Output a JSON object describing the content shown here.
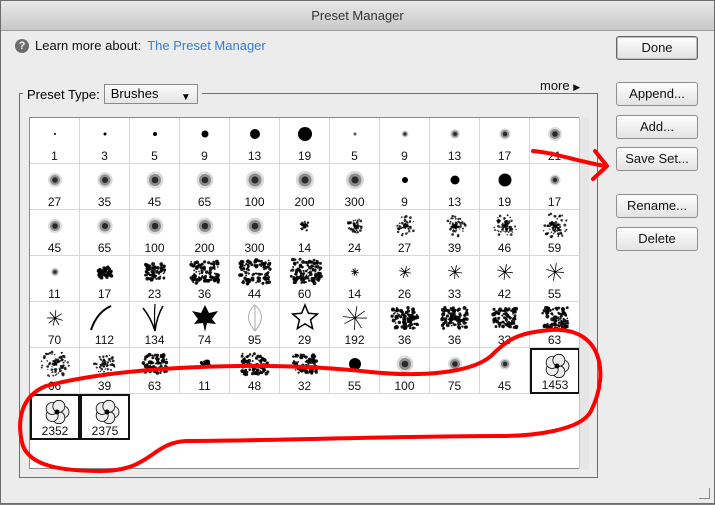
{
  "window": {
    "title": "Preset Manager"
  },
  "learn": {
    "prefix": "Learn more about:",
    "link": "The Preset Manager",
    "icon": "help-icon"
  },
  "buttons": {
    "done": "Done",
    "append": "Append...",
    "add": "Add...",
    "save_set": "Save Set...",
    "rename": "Rename...",
    "delete": "Delete"
  },
  "preset_type": {
    "label": "Preset Type:",
    "value": "Brushes"
  },
  "more": "more",
  "brushes": [
    {
      "label": "1",
      "style": "dot",
      "size": 1
    },
    {
      "label": "3",
      "style": "dot",
      "size": 1.5
    },
    {
      "label": "5",
      "style": "dot",
      "size": 2
    },
    {
      "label": "9",
      "style": "dot",
      "size": 3.5
    },
    {
      "label": "13",
      "style": "dot",
      "size": 5
    },
    {
      "label": "19",
      "style": "dot",
      "size": 7
    },
    {
      "label": "5",
      "style": "soft",
      "size": 1.5
    },
    {
      "label": "9",
      "style": "soft",
      "size": 2.5
    },
    {
      "label": "13",
      "style": "soft",
      "size": 3.5
    },
    {
      "label": "17",
      "style": "soft",
      "size": 4
    },
    {
      "label": "21",
      "style": "soft",
      "size": 5
    },
    {
      "label": "27",
      "style": "soft",
      "size": 5
    },
    {
      "label": "35",
      "style": "soft",
      "size": 5.5
    },
    {
      "label": "45",
      "style": "soft",
      "size": 6
    },
    {
      "label": "65",
      "style": "soft",
      "size": 6
    },
    {
      "label": "100",
      "style": "soft",
      "size": 6.5
    },
    {
      "label": "200",
      "style": "soft",
      "size": 6.5
    },
    {
      "label": "300",
      "style": "soft",
      "size": 6.5
    },
    {
      "label": "9",
      "style": "dot",
      "size": 3
    },
    {
      "label": "13",
      "style": "dot",
      "size": 4.5
    },
    {
      "label": "19",
      "style": "dot",
      "size": 6.5
    },
    {
      "label": "17",
      "style": "soft",
      "size": 4
    },
    {
      "label": "45",
      "style": "soft",
      "size": 5
    },
    {
      "label": "65",
      "style": "soft",
      "size": 5.5
    },
    {
      "label": "100",
      "style": "soft",
      "size": 6
    },
    {
      "label": "200",
      "style": "soft",
      "size": 6
    },
    {
      "label": "300",
      "style": "soft",
      "size": 6
    },
    {
      "label": "14",
      "style": "spatter",
      "size": 5
    },
    {
      "label": "24",
      "style": "spatter",
      "size": 8
    },
    {
      "label": "27",
      "style": "spatter",
      "size": 10
    },
    {
      "label": "39",
      "style": "spatter",
      "size": 11
    },
    {
      "label": "46",
      "style": "spatter",
      "size": 12
    },
    {
      "label": "59",
      "style": "spatter",
      "size": 13
    },
    {
      "label": "11",
      "style": "soft",
      "size": 3
    },
    {
      "label": "17",
      "style": "chalk",
      "size": 7
    },
    {
      "label": "23",
      "style": "chalk",
      "size": 10
    },
    {
      "label": "36",
      "style": "chalk",
      "size": 14
    },
    {
      "label": "44",
      "style": "chalk",
      "size": 15
    },
    {
      "label": "60",
      "style": "chalk",
      "size": 16
    },
    {
      "label": "14",
      "style": "star",
      "size": 4
    },
    {
      "label": "26",
      "style": "star",
      "size": 6
    },
    {
      "label": "33",
      "style": "star",
      "size": 7
    },
    {
      "label": "42",
      "style": "star",
      "size": 8
    },
    {
      "label": "55",
      "style": "star",
      "size": 9
    },
    {
      "label": "70",
      "style": "star",
      "size": 8
    },
    {
      "label": "112",
      "style": "stroke",
      "size": 16
    },
    {
      "label": "134",
      "style": "grass",
      "size": 14
    },
    {
      "label": "74",
      "style": "leaf",
      "size": 14
    },
    {
      "label": "95",
      "style": "leaf-outline",
      "size": 14
    },
    {
      "label": "29",
      "style": "star-outline",
      "size": 13
    },
    {
      "label": "192",
      "style": "star",
      "size": 12
    },
    {
      "label": "36",
      "style": "chalk",
      "size": 13
    },
    {
      "label": "36",
      "style": "chalk",
      "size": 13
    },
    {
      "label": "33",
      "style": "chalk",
      "size": 12
    },
    {
      "label": "63",
      "style": "chalk",
      "size": 13
    },
    {
      "label": "66",
      "style": "spatter",
      "size": 14
    },
    {
      "label": "39",
      "style": "spatter",
      "size": 11
    },
    {
      "label": "63",
      "style": "chalk",
      "size": 12
    },
    {
      "label": "11",
      "style": "chalk",
      "size": 4
    },
    {
      "label": "48",
      "style": "chalk",
      "size": 13
    },
    {
      "label": "32",
      "style": "chalk",
      "size": 12
    },
    {
      "label": "55",
      "style": "dot",
      "size": 6
    },
    {
      "label": "100",
      "style": "soft",
      "size": 6
    },
    {
      "label": "75",
      "style": "soft",
      "size": 5
    },
    {
      "label": "45",
      "style": "soft",
      "size": 4
    },
    {
      "label": "1453",
      "style": "flower",
      "size": 14,
      "selected": true
    },
    {
      "label": "2352",
      "style": "flower",
      "size": 14,
      "selected": true
    },
    {
      "label": "2375",
      "style": "flower",
      "size": 14,
      "selected": true
    }
  ]
}
